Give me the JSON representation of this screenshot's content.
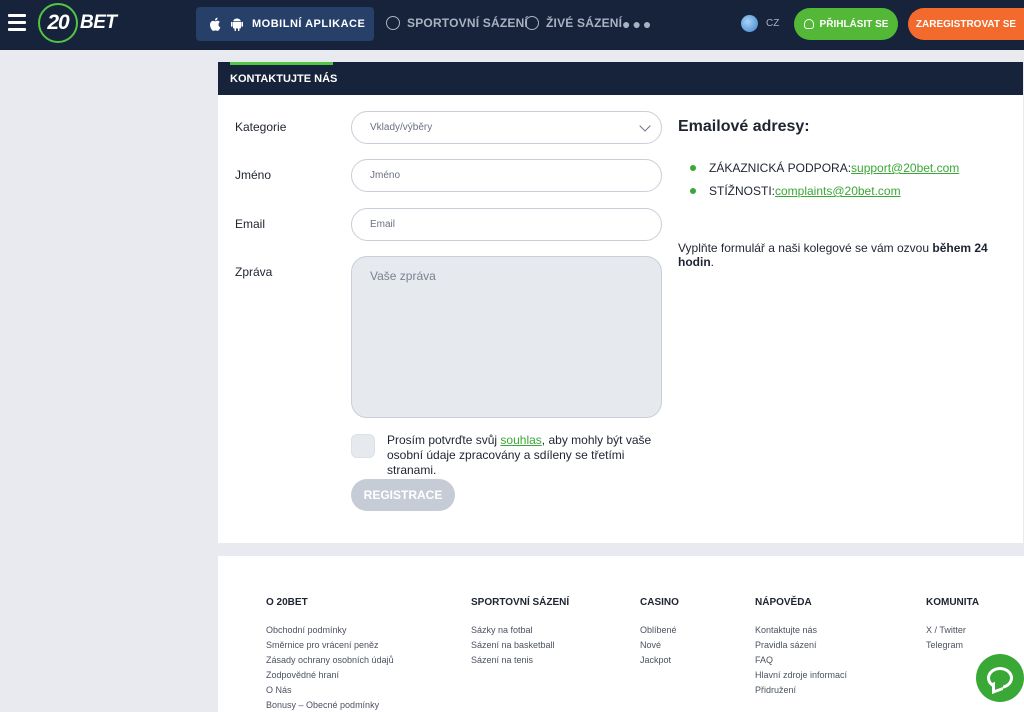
{
  "header": {
    "logo_number": "20",
    "logo_text": "BET",
    "mobile_app_label": "MOBILNÍ APLIKACE",
    "nav": [
      {
        "label": "SPORTOVNÍ SÁZENÍ",
        "icon": "soccer-ball-icon"
      },
      {
        "label": "ŽIVÉ SÁZENÍ",
        "icon": "live-icon"
      }
    ],
    "more_label": "●●●",
    "language": "CZ",
    "login_label": "PŘIHLÁSIT SE",
    "register_label": "ZAREGISTROVAT SE"
  },
  "contact": {
    "title": "KONTAKTUJTE NÁS",
    "fields": {
      "category_label": "Kategorie",
      "category_value": "Vklady/výběry",
      "name_label": "Jméno",
      "name_placeholder": "Jméno",
      "email_label": "Email",
      "email_placeholder": "Email",
      "message_label": "Zpráva",
      "message_placeholder": "Vaše zpráva"
    },
    "consent": {
      "before": "Prosím potvrďte svůj ",
      "link": "souhlas",
      "after": ", aby mohly být vaše osobní údaje zpracovány a sdíleny se třetími stranami."
    },
    "submit_label": "REGISTRACE",
    "emails_title": "Emailové adresy:",
    "emails": [
      {
        "label": "ZÁKAZNICKÁ PODPORA:",
        "address": "support@20bet.com"
      },
      {
        "label": "STÍŽNOSTI:",
        "address": "complaints@20bet.com"
      }
    ],
    "note_prefix": "Vyplňte formulář a naši kolegové se vám ozvou ",
    "note_bold": "během 24 hodin",
    "note_suffix": "."
  },
  "footer": {
    "columns": [
      {
        "title": "O 20BET",
        "links": [
          "Obchodní podmínky",
          "Směrnice pro vrácení peněz",
          "Zásady ochrany osobních údajů",
          "Zodpovědné hraní",
          "O Nás",
          "Bonusy – Obecné podmínky"
        ]
      },
      {
        "title": "SPORTOVNÍ SÁZENÍ",
        "links": [
          "Sázky na fotbal",
          "Sázení na basketball",
          "Sázení na tenis"
        ]
      },
      {
        "title": "CASINO",
        "links": [
          "Oblíbené",
          "Nové",
          "Jackpot"
        ]
      },
      {
        "title": "NÁPOVĚDA",
        "links": [
          "Kontaktujte nás",
          "Pravidla sázení",
          "FAQ",
          "Hlavní zdroje informací",
          "Přidružení"
        ]
      },
      {
        "title": "KOMUNITA",
        "links": [
          "X / Twitter",
          "Telegram"
        ]
      }
    ]
  },
  "colors": {
    "header_bg": "#16233a",
    "accent_green": "#53b737",
    "accent_orange": "#f26b2d",
    "link_green": "#3aa836"
  }
}
